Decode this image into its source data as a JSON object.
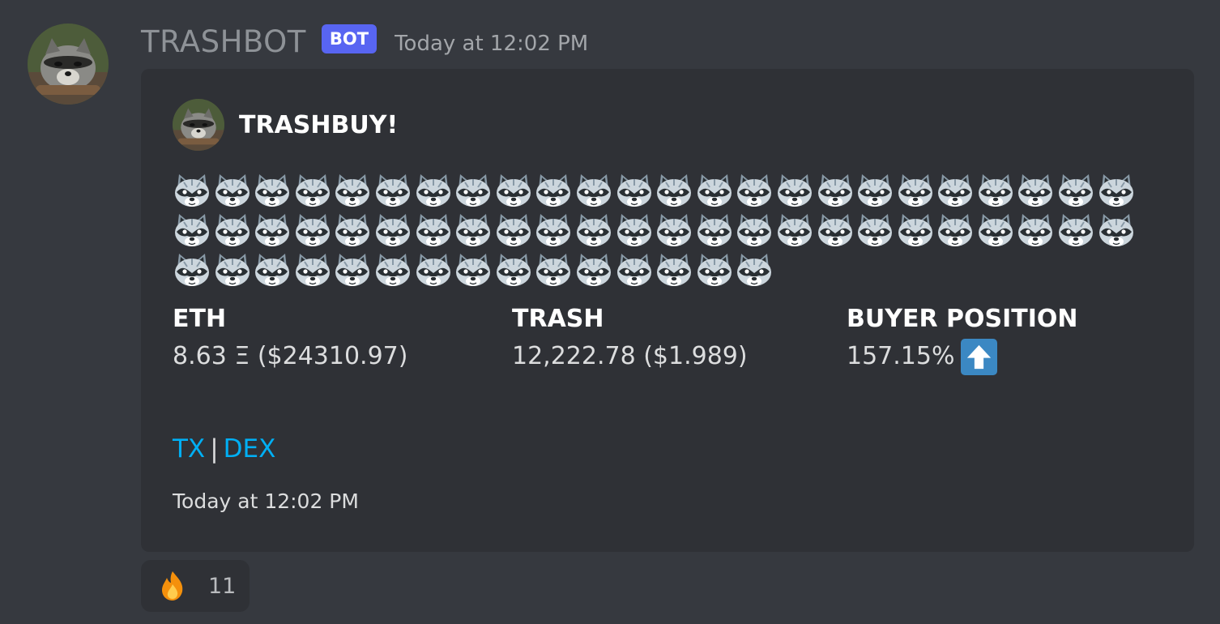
{
  "message": {
    "username": "TRASHBOT",
    "bot_tag": "BOT",
    "timestamp": "Today at 12:02 PM",
    "avatar_icon": "raccoon-photo-avatar"
  },
  "embed": {
    "author_name": "TRASHBUY!",
    "author_icon": "raccoon-photo-avatar",
    "description_emoji": "raccoon-emoji",
    "description_emoji_rows": [
      24,
      24,
      15
    ],
    "fields": [
      {
        "name": "ETH",
        "value": "8.63 Ξ ($24310.97)"
      },
      {
        "name": "TRASH",
        "value": "12,222.78 ($1.989)"
      },
      {
        "name": "BUYER POSITION",
        "value": "157.15%",
        "icon": "arrow-up-emoji"
      }
    ],
    "links": {
      "tx": "TX",
      "separator": "|",
      "dex": "DEX"
    },
    "footer_timestamp": "Today at 12:02 PM"
  },
  "reaction": {
    "emoji": "fire-emoji",
    "count": "11"
  },
  "colors": {
    "background": "#36393f",
    "embed_background": "#2f3136",
    "bot_tag": "#5865f2",
    "link": "#00aff4",
    "arrow_emoji": "#3b88c3"
  }
}
